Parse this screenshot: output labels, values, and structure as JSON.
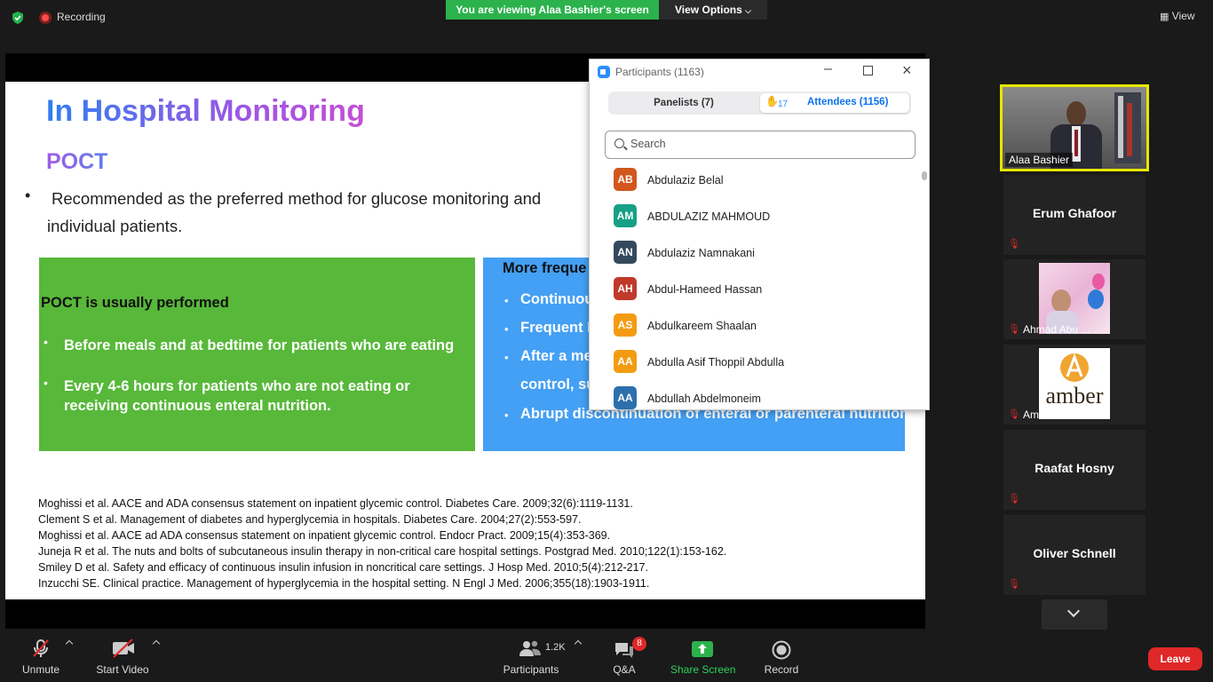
{
  "top_bar": {
    "recording_label": "Recording",
    "viewing_banner": "You are viewing Alaa Bashier's screen",
    "view_options": "View Options",
    "view_button": "View"
  },
  "slide": {
    "title": "In Hospital Monitoring",
    "subtitle": "POCT",
    "bullet": "Recommended as the preferred method for glucose monitoring and",
    "bullet_line2": "individual patients.",
    "green_box": {
      "heading": "POCT is usually performed",
      "items": [
        "Before meals and at bedtime for patients who are eating",
        "Every 4-6 hours for patients who are not eating or",
        "receiving continuous enteral nutrition."
      ]
    },
    "blue_box": {
      "heading": "More freque",
      "items": [
        "Continuou",
        "Frequent I",
        "After a me",
        "control, su",
        "Abrupt discontinuation of enteral or parenteral nutrition"
      ]
    },
    "references": [
      "Moghissi et al. AACE and ADA consensus statement on inpatient glycemic control. Diabetes Care. 2009;32(6):1119-1131.",
      "Clement S et al. Management of diabetes and hyperglycemia in hospitals. Diabetes Care. 2004;27(2):553-597.",
      "Moghissi et al. AACE ad ADA consensus statement on inpatient glycemic control. Endocr Pract. 2009;15(4):353-369.",
      "Juneja R et al. The nuts and bolts of subcutaneous insulin therapy in non-critical care hospital settings. Postgrad Med. 2010;122(1):153-162.",
      "Smiley D et al. Safety and efficacy of continuous insulin infusion in noncritical care settings. J Hosp Med. 2010;5(4):212-217.",
      "Inzucchi SE. Clinical practice. Management of hyperglycemia in the hospital setting. N Engl J Med. 2006;355(18):1903-1911."
    ]
  },
  "participants_panel": {
    "title": "Participants (1163)",
    "panelists_tab": "Panelists (7)",
    "raised_hands": "17",
    "attendees_tab": "Attendees (1156)",
    "search_placeholder": "Search",
    "participants": [
      {
        "initials": "AB",
        "name": "Abdulaziz Belal",
        "color": "#d2571d"
      },
      {
        "initials": "AM",
        "name": "ABDULAZIZ MAHMOUD",
        "color": "#16a085"
      },
      {
        "initials": "AN",
        "name": "Abdulaziz Namnakani",
        "color": "#34495e"
      },
      {
        "initials": "AH",
        "name": "Abdul-Hameed Hassan",
        "color": "#c0392b"
      },
      {
        "initials": "AS",
        "name": "Abdulkareem Shaalan",
        "color": "#f39c12"
      },
      {
        "initials": "AA",
        "name": "Abdulla Asif Thoppil Abdulla",
        "color": "#f39c12"
      },
      {
        "initials": "AA",
        "name": "Abdullah Abdelmoneim",
        "color": "#2c6fad"
      }
    ]
  },
  "gallery": {
    "active_speaker": "Alaa Bashier",
    "tiles": [
      {
        "name": "Erum Ghafoor"
      },
      {
        "name": "Ahmad Abu ..."
      },
      {
        "name": "Amr Hussein"
      },
      {
        "name": "Raafat Hosny"
      },
      {
        "name": "Oliver Schnell"
      }
    ]
  },
  "toolbar": {
    "unmute": "Unmute",
    "start_video": "Start Video",
    "participants": "Participants",
    "participant_count": "1.2K",
    "qa": "Q&A",
    "qa_badge": "8",
    "share_screen": "Share Screen",
    "record": "Record",
    "leave": "Leave"
  },
  "colors": {
    "zoom_blue": "#2d8cff",
    "share_green": "#2bb24c",
    "leave_red": "#e02828",
    "active_border": "#e6e600"
  }
}
